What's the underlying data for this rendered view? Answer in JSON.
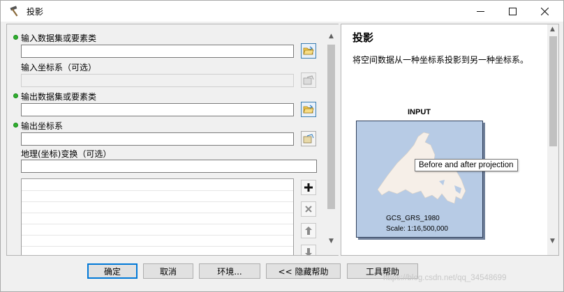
{
  "window": {
    "title": "投影",
    "minimize_icon": "minimize-icon",
    "maximize_icon": "maximize-icon",
    "close_icon": "close-icon"
  },
  "form": {
    "input_dataset_label": "输入数据集或要素类",
    "input_dataset_value": "",
    "input_crs_label": "输入坐标系（可选）",
    "input_crs_value": "",
    "output_dataset_label": "输出数据集或要素类",
    "output_dataset_value": "",
    "output_crs_label": "输出坐标系",
    "output_crs_value": "",
    "transform_label": "地理(坐标)变换（可选）",
    "transform_value": "",
    "side_buttons": [
      "add-icon",
      "remove-icon",
      "move-up-icon",
      "move-down-icon"
    ],
    "required_color": "#2fb02f"
  },
  "help": {
    "title": "投影",
    "description": "将空间数据从一种坐标系投影到另一种坐标系。",
    "diagram_label": "INPUT",
    "gcs": "GCS_GRS_1980",
    "scale": "Scale: 1:16,500,000",
    "tooltip": "Before and after projection"
  },
  "buttons": {
    "ok": "确定",
    "cancel": "取消",
    "environments": "环境...",
    "hide_help": "<< 隐藏帮助",
    "tool_help": "工具帮助"
  },
  "watermark": "https://blog.csdn.net/qq_34548699"
}
